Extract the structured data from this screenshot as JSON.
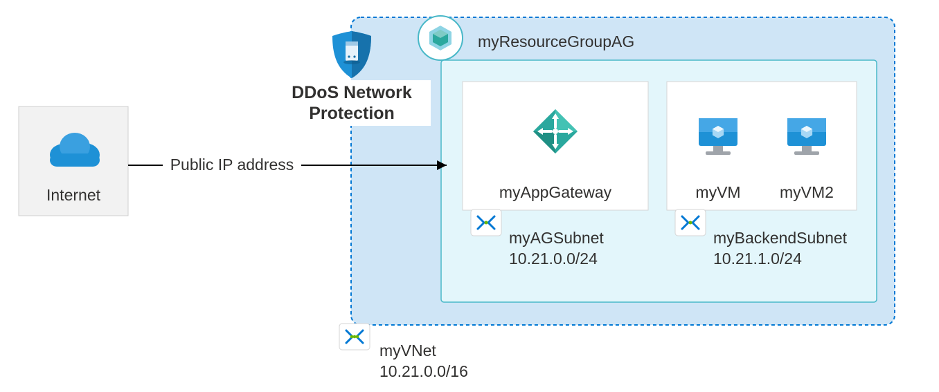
{
  "internet_label": "Internet",
  "public_ip_label": "Public IP address",
  "ddos_label_line1": "DDoS Network",
  "ddos_label_line2": "Protection",
  "resource_group_name": "myResourceGroupAG",
  "app_gateway_name": "myAppGateway",
  "vm1_name": "myVM",
  "vm2_name": "myVM2",
  "ag_subnet_name": "myAGSubnet",
  "ag_subnet_cidr": "10.21.0.0/24",
  "backend_subnet_name": "myBackendSubnet",
  "backend_subnet_cidr": "10.21.1.0/24",
  "vnet_name": "myVNet",
  "vnet_cidr": "10.21.0.0/16",
  "colors": {
    "azure_blue": "#0078d4",
    "light_blue_fill": "#cfe5f6",
    "inner_fill": "#e3f6fb",
    "teal": "#2aa89e"
  }
}
